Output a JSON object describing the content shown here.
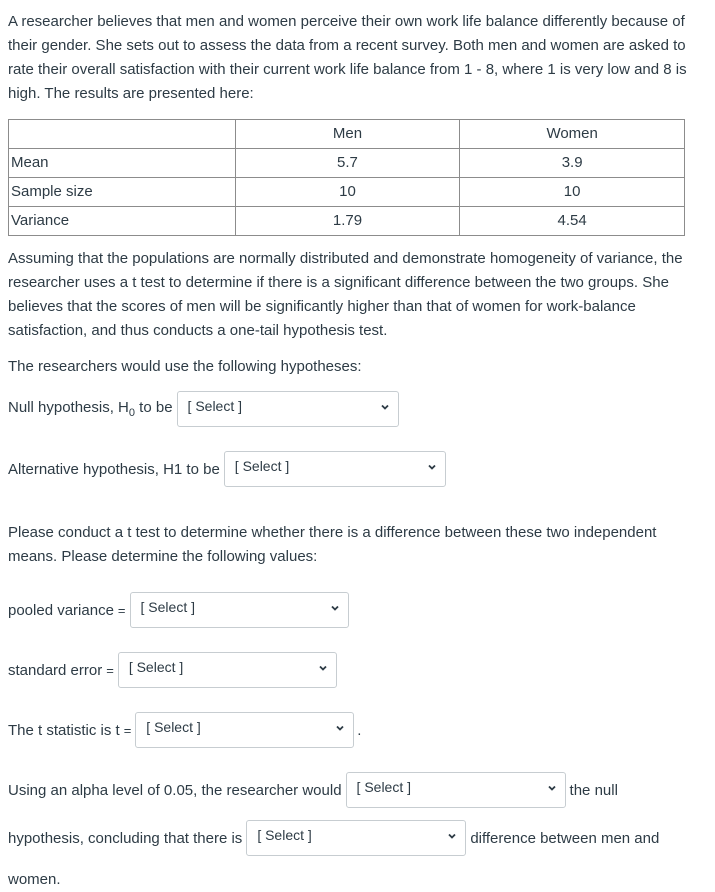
{
  "intro": "A researcher believes that men and women perceive their own work life balance differently because of their gender. She sets out to assess the data from a recent survey. Both men and women are asked to rate their overall satisfaction with their current work life balance from 1 - 8, where 1 is very low and 8 is high. The results are presented here:",
  "table": {
    "headers": [
      "",
      "Men",
      "Women"
    ],
    "rows": [
      {
        "label": "Mean",
        "men": "5.7",
        "women": "3.9"
      },
      {
        "label": "Sample size",
        "men": "10",
        "women": "10"
      },
      {
        "label": "Variance",
        "men": "1.79",
        "women": "4.54"
      }
    ]
  },
  "para2": "Assuming that the populations are normally distributed and demonstrate homogeneity of variance, the researcher uses a t test to determine if there is a significant difference between the two groups. She believes that the scores of men will be significantly higher than that of women for work-balance satisfaction, and thus conducts a one-tail hypothesis test.",
  "hypotheses_intro": "The researchers would use the following hypotheses:",
  "null_label_pre": "Null hypothesis, H",
  "null_label_sub": "0",
  "null_label_post": " to be",
  "alt_label": "Alternative hypothesis, H1 to be",
  "para3": "Please conduct a t test to determine whether there is a difference between these two independent means. Please determine the following values:",
  "pooled_label": "pooled variance",
  "se_label": "standard error",
  "t_label": "The t statistic is t",
  "equals": "=",
  "period": ".",
  "alpha_pre": "Using an alpha level of 0.05, the researcher would",
  "alpha_post": "the null",
  "conclude_pre": "hypothesis, concluding that there is",
  "conclude_post": "difference between men and",
  "women_end": "women.",
  "select_placeholder": "[ Select ]"
}
